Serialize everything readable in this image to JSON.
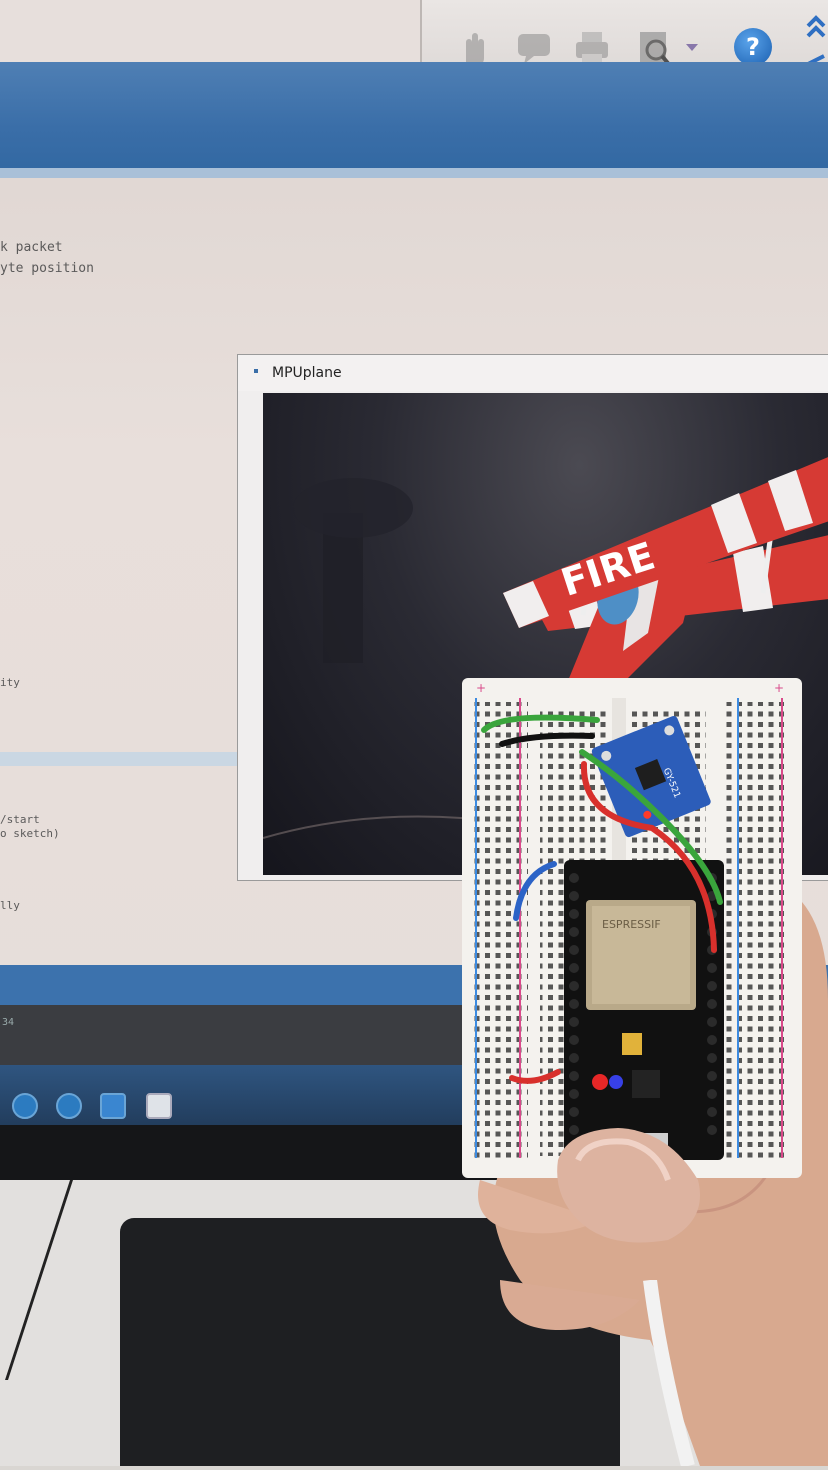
{
  "toolbar": {
    "icons": [
      "hand-icon",
      "comment-icon",
      "print-icon",
      "zoom-icon",
      "help-icon",
      "collapse-icon"
    ]
  },
  "editor": {
    "lines": [
      "k packet",
      "yte position",
      "ity",
      "/start",
      "o sketch)",
      "lly"
    ],
    "console_line": "34"
  },
  "mpu_window": {
    "title": "MPUplane",
    "plane_text": "FIRE"
  },
  "breadboard": {
    "module_label": "GY-521",
    "chip_label": "ESPRESSIF"
  },
  "colors": {
    "header_blue": "#3a6ea8",
    "plane_red": "#d63a34",
    "wire_green": "#3aa53c",
    "wire_red": "#d8302c",
    "wire_blue": "#2b63c7"
  }
}
